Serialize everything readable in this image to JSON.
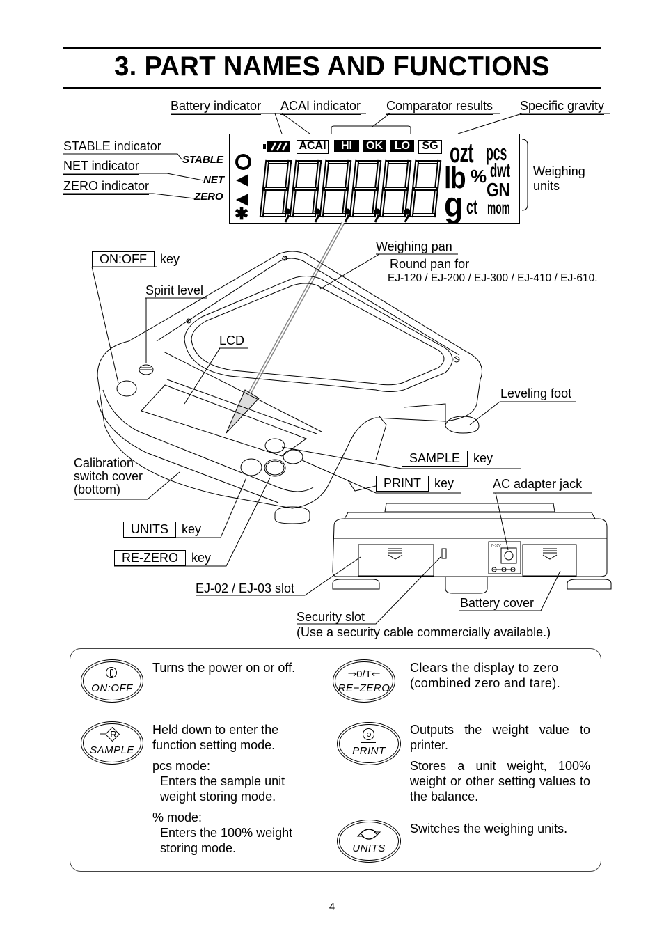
{
  "page": {
    "title": "3. PART NAMES AND FUNCTIONS",
    "page_number": "4"
  },
  "lcd_callouts": {
    "battery": "Battery indicator",
    "acai": "ACAI indicator",
    "comparator": "Comparator results",
    "specific_gravity": "Specific gravity",
    "stable": "STABLE indicator",
    "net": "NET indicator",
    "zero": "ZERO indicator",
    "weighing_units_line1": "Weighing",
    "weighing_units_line2": "units"
  },
  "lcd": {
    "indicators": {
      "stable": "STABLE",
      "net": "NET",
      "zero": "ZERO"
    },
    "tags": [
      "ACAI",
      "HI",
      "OK",
      "LO",
      "SG"
    ],
    "digits": "8,8,8,8,8,8",
    "units": {
      "ozt": "ozt",
      "pcs": "pcs",
      "lb": "lb",
      "percent": "%",
      "dwt": "dwt",
      "g": "g",
      "ct": "ct",
      "gn": "GN",
      "mom": "mom"
    },
    "symbols": {
      "stable": "O",
      "net": "◀",
      "zero": "◀",
      "star": "✱"
    }
  },
  "diagram_labels": {
    "on_off_key": "ON:OFF",
    "key_suffix": "key",
    "spirit_level": "Spirit level",
    "weighing_pan": "Weighing pan",
    "round_pan": "Round pan for",
    "round_pan_models": "EJ-120 / EJ-200 / EJ-300 / EJ-410 / EJ-610.",
    "lcd": "LCD",
    "leveling_foot": "Leveling foot",
    "sample_key": "SAMPLE",
    "print_key": "PRINT",
    "ac_adapter": "AC adapter jack",
    "calibration_line1": "Calibration",
    "calibration_line2": "switch cover",
    "calibration_line3": "(bottom)",
    "units_key": "UNITS",
    "rezero_key": "RE-ZERO",
    "ej_slot": "EJ-02 / EJ-03 slot",
    "battery_cover": "Battery cover",
    "security_slot": "Security slot",
    "security_note": "(Use a security cable commercially available.)",
    "scale_mini_indicators": [
      "STABLE",
      "NET",
      "ZERO"
    ],
    "jack_label": "7~10V"
  },
  "key_functions": {
    "on_off": {
      "icon_label": "ON:OFF",
      "glyph": "power-icon",
      "desc": "Turns the power on or off."
    },
    "sample": {
      "icon_label": "SAMPLE",
      "glyph": "R",
      "desc1": "Held down to enter the function setting mode.",
      "pcs_head": "pcs mode:",
      "pcs_desc": "Enters the sample unit weight storing mode.",
      "pct_head": "% mode:",
      "pct_desc": "Enters the 100% weight storing mode."
    },
    "rezero": {
      "icon_label": "RE−ZERO",
      "glyph": "⇒0/T⇐",
      "desc": "Clears the display to zero (combined zero and tare)."
    },
    "print": {
      "icon_label": "PRINT",
      "glyph": "print-icon",
      "desc1": "Outputs the weight value to printer.",
      "desc2": "Stores a unit weight, 100% weight or other setting values to the balance."
    },
    "units": {
      "icon_label": "UNITS",
      "glyph": "cycle-icon",
      "desc": "Switches the weighing units."
    }
  }
}
